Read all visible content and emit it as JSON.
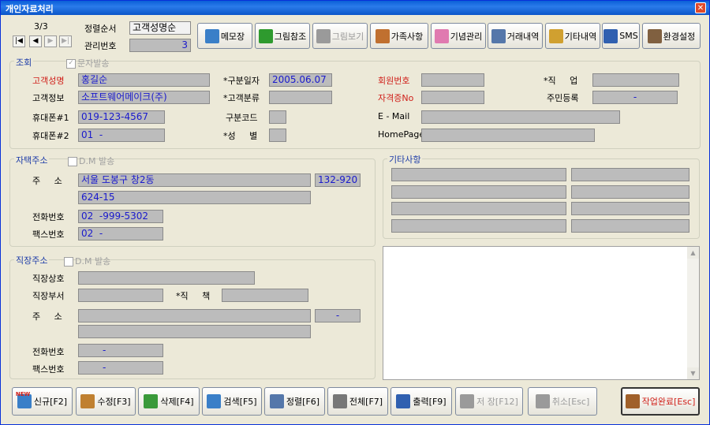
{
  "window": {
    "title": "개인자료처리"
  },
  "record_nav": {
    "counter": "3/3"
  },
  "header": {
    "sort_label": "정렬순서",
    "sort_value": "고객성명순",
    "mgmt_label": "관리번호",
    "mgmt_value": "3"
  },
  "toolbar": [
    {
      "label": "메모장",
      "icon": "notepad-icon",
      "color": "#3A7FC8",
      "enabled": true
    },
    {
      "label": "그림참조",
      "icon": "tree-icon",
      "color": "#2E9A2E",
      "enabled": true
    },
    {
      "label": "그림보기",
      "icon": "tree-gray-icon",
      "color": "#9A9A9A",
      "enabled": false
    },
    {
      "label": "가족사항",
      "icon": "family-icon",
      "color": "#C07030",
      "enabled": true
    },
    {
      "label": "기념관리",
      "icon": "cake-icon",
      "color": "#E07AB0",
      "enabled": true
    },
    {
      "label": "거래내역",
      "icon": "document-icon",
      "color": "#5577AA",
      "enabled": true
    },
    {
      "label": "기타내역",
      "icon": "clipboard-icon",
      "color": "#D0A030",
      "enabled": true
    },
    {
      "label": "SMS",
      "icon": "phone-icon",
      "color": "#3060B0",
      "enabled": true
    },
    {
      "label": "환경설정",
      "icon": "tools-icon",
      "color": "#806040",
      "enabled": true
    }
  ],
  "lookup": {
    "group_title": "조회",
    "sms_check_label": "문자발송",
    "customer_name_label": "고객성명",
    "customer_name": "홍길순",
    "category_date_label": "*구분일자",
    "category_date": "2005.06.07",
    "member_no_label": "회원번호",
    "member_no": "",
    "job_label": "*직     업",
    "job": "",
    "customer_info_label": "고객정보",
    "customer_info": "소프트웨어메이크(주)",
    "category_class_label": "*고객분류",
    "category_class": "",
    "license_label": "자격증No",
    "license": "",
    "resident_label": "주민등록",
    "resident": "-",
    "mobile1_label": "휴대폰#1",
    "mobile1": "019-123-4567",
    "category_code_label": "구분코드",
    "category_code": "",
    "email_label": "E - Mail",
    "email": "",
    "mobile2_label": "휴대폰#2",
    "mobile2": "01  -",
    "gender_label": "*성     별",
    "gender": "",
    "homepage_label": "HomePage",
    "homepage": ""
  },
  "home": {
    "group_title": "자택주소",
    "dm_label": "D.M 발송",
    "address_label": "주     소",
    "address1": "서울 도봉구 창2동",
    "zip": "132-920",
    "address2": "624-15",
    "phone_label": "전화번호",
    "phone": "02  -999-5302",
    "fax_label": "팩스번호",
    "fax": "02  -"
  },
  "etc": {
    "group_title": "기타사항"
  },
  "work": {
    "group_title": "직장주소",
    "dm_label": "D.M 발송",
    "company_label": "직장상호",
    "company": "",
    "dept_label": "직장부서",
    "dept": "",
    "position_label": "*직     책",
    "position": "",
    "address_label": "주     소",
    "address1": "",
    "zip": "-",
    "address2": "",
    "phone_label": "전화번호",
    "phone": "-",
    "fax_label": "팩스번호",
    "fax": "-"
  },
  "bottom_buttons": [
    {
      "label": "신규[F2]",
      "icon": "new-user-icon",
      "enabled": true,
      "badge": "NEW"
    },
    {
      "label": "수정[F3]",
      "icon": "edit-icon",
      "enabled": true
    },
    {
      "label": "삭제[F4]",
      "icon": "delete-user-icon",
      "enabled": true
    },
    {
      "label": "검색[F5]",
      "icon": "search-icon",
      "enabled": true
    },
    {
      "label": "정렬[F6]",
      "icon": "sort-icon",
      "enabled": true
    },
    {
      "label": "전체[F7]",
      "icon": "list-icon",
      "enabled": true
    },
    {
      "label": "출력[F9]",
      "icon": "print-icon",
      "enabled": true
    },
    {
      "label": "저 장[F12]",
      "icon": "save-icon",
      "enabled": false
    },
    {
      "label": "취소[Esc]",
      "icon": "cancel-icon",
      "enabled": false
    },
    {
      "label": "작업완료[Esc]",
      "icon": "exit-door-icon",
      "enabled": true,
      "accent": "#D0201A"
    }
  ]
}
